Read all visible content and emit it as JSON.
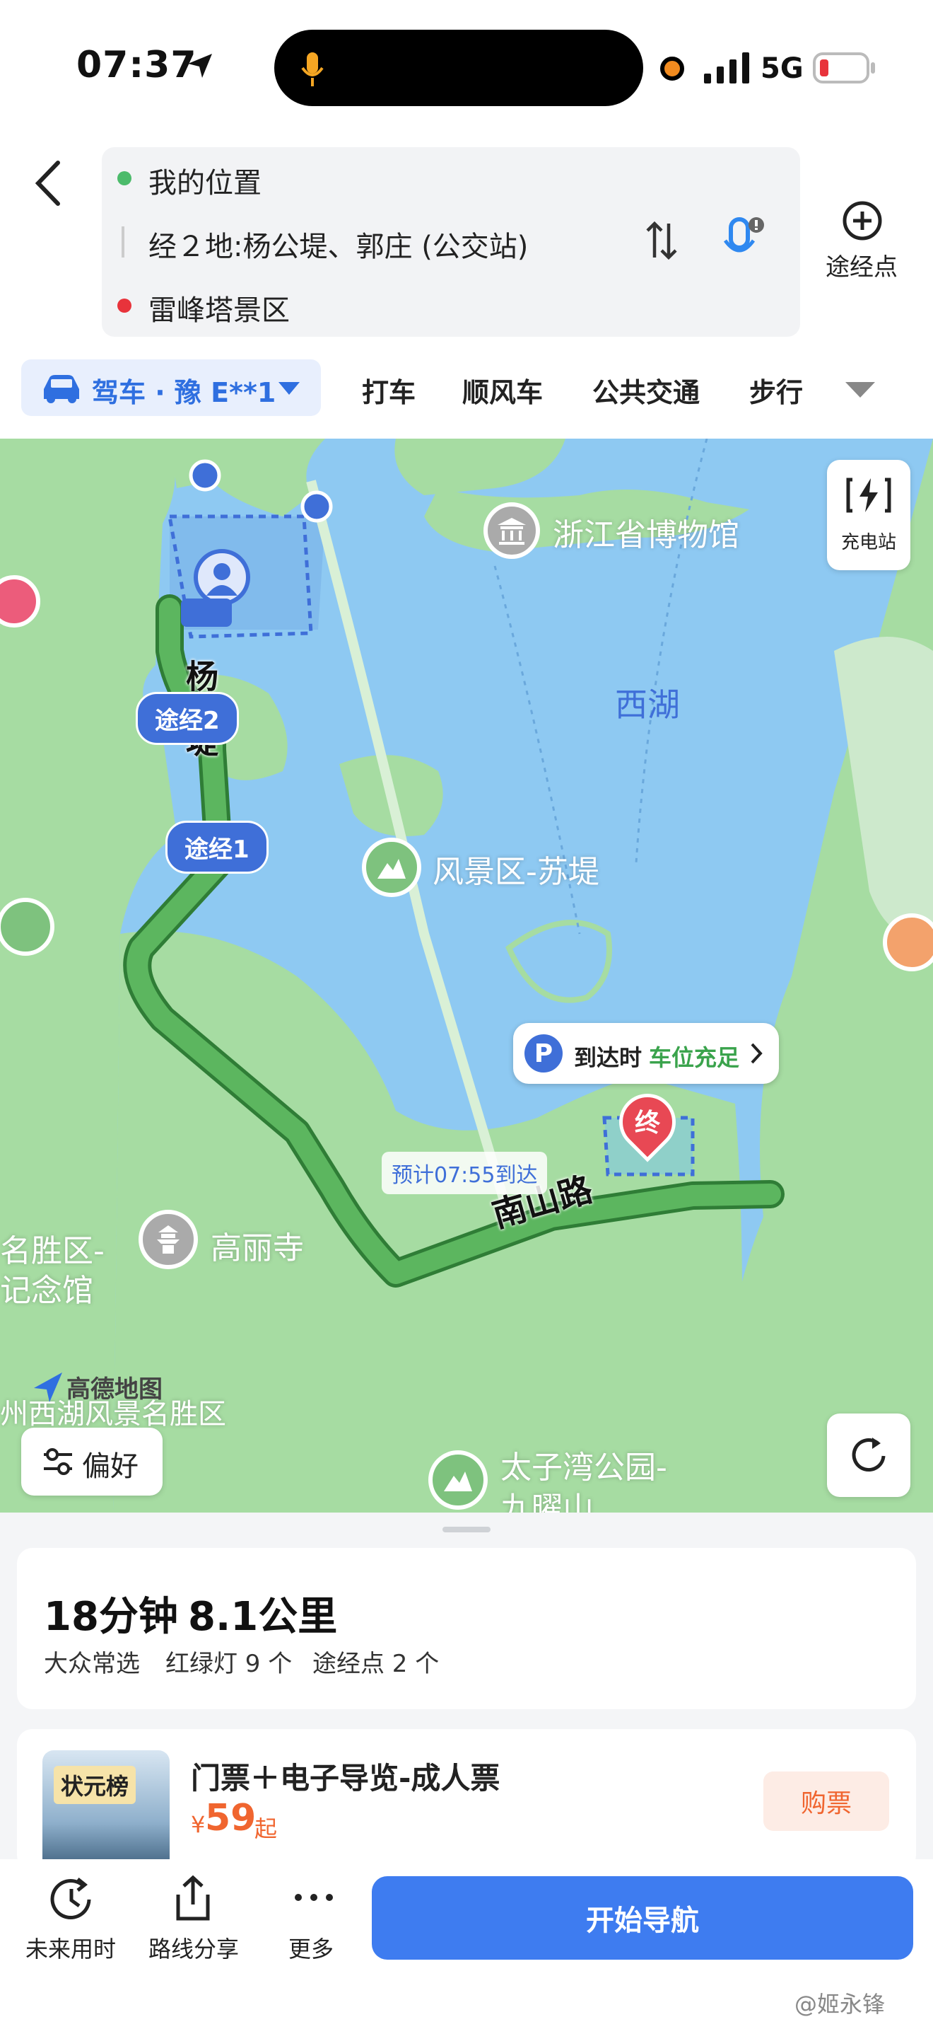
{
  "status_bar": {
    "time": "07:37",
    "network": "5G"
  },
  "route": {
    "origin": "我的位置",
    "via": "经２地:杨公堤、郭庄 (公交站)",
    "destination": "雷峰塔景区",
    "add_waypoint_label": "途经点"
  },
  "modes": {
    "active": "驾车 · 豫 E**1",
    "items": [
      "打车",
      "顺风车",
      "公共交通",
      "步行"
    ]
  },
  "map": {
    "poi_museum": "浙江省博物馆",
    "lake": "西湖",
    "poi_sudi": "风景区-苏堤",
    "poi_gaolisi": "高丽寺",
    "poi_taiziwan_1": "太子湾公园-",
    "poi_taiziwan_2": "九曜山",
    "left_label_1": "名胜区-",
    "left_label_2": "记念馆",
    "area_label": "州西湖风景名胜区",
    "logo": "高德地图",
    "road_yanggongdi": "杨公堤",
    "road_nanshan": "南山路",
    "via2": "途经2",
    "via1": "途经1",
    "eta_tag": "预计07:55到达",
    "parking_prefix": "到达时",
    "parking_status": "车位充足",
    "end_marker": "终",
    "charging_label": "充电站",
    "pref_label": "偏好"
  },
  "summary": {
    "duration": "18分钟",
    "distance": "8.1公里",
    "tag": "大众常选",
    "lights": "红绿灯 9 个",
    "waypoints": "途经点 2 个"
  },
  "ticket": {
    "thumb_text": "状元榜",
    "title": "门票＋电子导览-成人票",
    "currency": "¥",
    "price": "59",
    "price_suffix": "起",
    "buy_label": "购票"
  },
  "bottom_bar": {
    "future_label": "未来用时",
    "share_label": "路线分享",
    "more_label": "更多",
    "start_label": "开始导航",
    "watermark": "@姬永锋"
  },
  "colors": {
    "accent": "#3e7cf0",
    "route": "#5cb65f",
    "water": "#8ec9f2",
    "land": "#a6dca2",
    "price": "#f0652f"
  }
}
